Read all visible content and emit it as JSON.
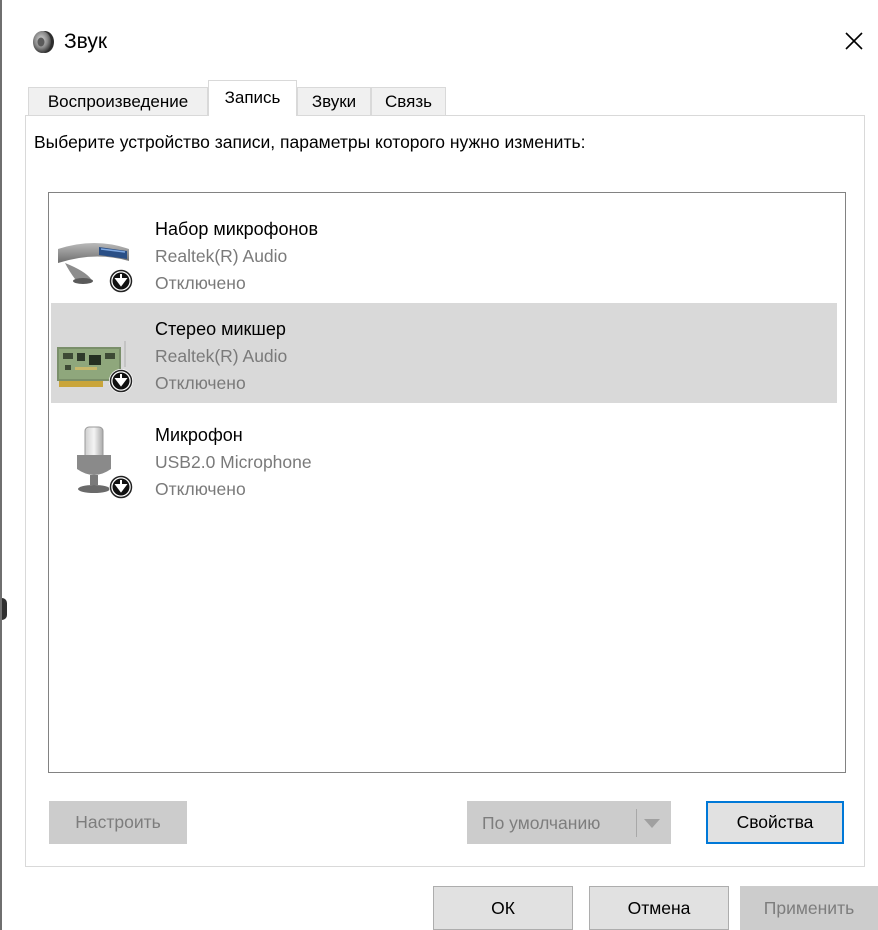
{
  "window": {
    "title": "Звук",
    "icon": "speaker-icon",
    "close_icon": "close-icon"
  },
  "tabs": [
    {
      "label": "Воспроизведение",
      "active": false
    },
    {
      "label": "Запись",
      "active": true
    },
    {
      "label": "Звуки",
      "active": false
    },
    {
      "label": "Связь",
      "active": false
    }
  ],
  "instruction": "Выберите устройство записи, параметры которого нужно изменить:",
  "devices": [
    {
      "name": "Набор микрофонов",
      "driver": "Realtek(R) Audio",
      "status": "Отключено",
      "icon": "microphone-array-icon",
      "selected": false
    },
    {
      "name": "Стерео микшер",
      "driver": "Realtek(R) Audio",
      "status": "Отключено",
      "icon": "sound-card-icon",
      "selected": true
    },
    {
      "name": "Микрофон",
      "driver": "USB2.0 Microphone",
      "status": "Отключено",
      "icon": "microphone-icon",
      "selected": false
    }
  ],
  "panel_buttons": {
    "configure": "Настроить",
    "set_default": "По умолчанию",
    "properties": "Свойства"
  },
  "footer_buttons": {
    "ok": "ОК",
    "cancel": "Отмена",
    "apply": "Применить"
  },
  "colors": {
    "selection": "#d9d9d9",
    "default_button_border": "#0078d7",
    "disabled_button": "#cccccc",
    "secondary_text": "#7a7a7a"
  }
}
